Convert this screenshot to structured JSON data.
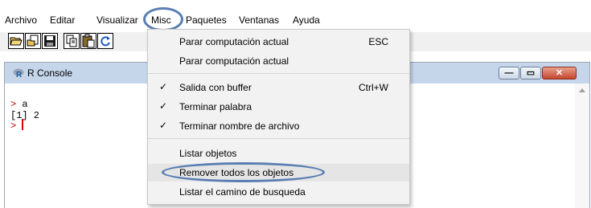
{
  "menubar": {
    "items": [
      {
        "label": "Archivo"
      },
      {
        "label": "Editar"
      },
      {
        "label": "Visualizar"
      },
      {
        "label": "Misc"
      },
      {
        "label": "Paquetes"
      },
      {
        "label": "Ventanas"
      },
      {
        "label": "Ayuda"
      }
    ]
  },
  "toolbar": {
    "buttons": [
      "open-script-icon",
      "load-workspace-icon",
      "save-icon",
      "copy-icon",
      "paste-icon",
      "refresh-icon"
    ]
  },
  "window": {
    "title": "R Console",
    "accent_color": "#c5d6ea"
  },
  "console": {
    "lines": [
      {
        "prompt": ">",
        "text": "a"
      },
      {
        "prompt": "",
        "text": "[1] 2"
      },
      {
        "prompt": ">",
        "text": ""
      }
    ],
    "prompt_color": "#c00000"
  },
  "misc_menu": {
    "items": [
      {
        "label": "Parar computación actual",
        "shortcut": "ESC",
        "checked": false
      },
      {
        "label": "Parar computación actual",
        "shortcut": "",
        "checked": false
      },
      {
        "label": "Salida con  buffer",
        "shortcut": "Ctrl+W",
        "checked": true
      },
      {
        "label": "Terminar palabra",
        "shortcut": "",
        "checked": true
      },
      {
        "label": "Terminar nombre de archivo",
        "shortcut": "",
        "checked": true
      },
      {
        "label": "Listar objetos",
        "shortcut": "",
        "checked": false
      },
      {
        "label": "Remover todos los objetos",
        "shortcut": "",
        "checked": false,
        "highlighted": true
      },
      {
        "label": "Listar el camino de busqueda",
        "shortcut": "",
        "checked": false
      }
    ],
    "check_glyph": "✓"
  },
  "highlight_color": "#5a7eb3"
}
